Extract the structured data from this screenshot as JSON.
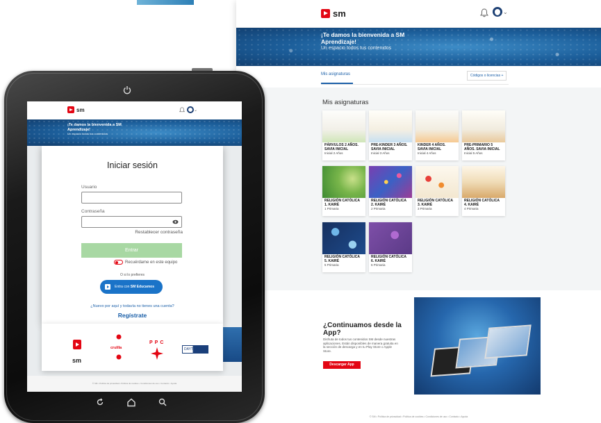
{
  "colors": {
    "brand_red": "#e30613",
    "link_blue": "#1a5fa8",
    "banner_blue": "#1c5e9a",
    "enter_green": "#a8d8a3"
  },
  "desktop": {
    "logo_text": "sm",
    "banner_title": "¡Te damos la bienvenida a SM Aprendizaje!",
    "banner_sub": "Un espacio todos tus contenidos",
    "tab_subjects": "Mis asignaturas",
    "codes_button": "Códigos o licencias +",
    "section_title": "Mis asignaturas",
    "cards": [
      {
        "title": "PÁRVULOS 2 AÑOS. SAVIA INICIAL",
        "sub": "Inicial 2 Años"
      },
      {
        "title": "PRE-KINDER 3 AÑOS. SAVIA INICIAL",
        "sub": "Inicial 3 Años"
      },
      {
        "title": "KINDER 4 AÑOS. SAVIA INICIAL",
        "sub": "Inicial 4 Años"
      },
      {
        "title": "PRE-PRIMARIO 5 AÑOS. SAVIA INICIAL",
        "sub": "Inicial 5 Años"
      },
      {
        "title": "RELIGIÓN CATÓLICA 1. KAIRÉ",
        "sub": "1 Primaria"
      },
      {
        "title": "RELIGIÓN CATÓLICA 2. KAIRÉ",
        "sub": "2 Primaria"
      },
      {
        "title": "RELIGIÓN CATÓLICA 3. KAIRÉ",
        "sub": "3 Primaria"
      },
      {
        "title": "RELIGIÓN CATÓLICA 4. KAIRÉ",
        "sub": "4 Primaria"
      },
      {
        "title": "RELIGIÓN CATÓLICA 5. KAIRÉ",
        "sub": "5 Primaria"
      },
      {
        "title": "RELIGIÓN CATÓLICA 6. KAIRÉ",
        "sub": "6 Primaria"
      }
    ],
    "app_title": "¿Continuamos desde la App?",
    "app_desc": "Disfruta de todos tus contenidos SM desde nuestras aplicaciones. Están disponibles de manera gratuita en la sección de descarga y en tu Play Store o Apple Store.",
    "app_button": "Descargar App",
    "footer": "© SM • Política de privacidad • Política de cookies • Condiciones de uso • Contacto • Ayuda"
  },
  "tablet": {
    "logo_text": "sm",
    "banner_title": "¡Te damos la bienvenida a SM Aprendizaje!",
    "banner_sub": "Un espacio todos tus contenidos",
    "login": {
      "title": "Iniciar sesión",
      "user_label": "Usuario",
      "user_value": "",
      "password_label": "Contraseña",
      "password_value": "",
      "reset_link": "Restablecer contraseña",
      "enter_button": "Entrar",
      "remember_label": "Recuérdame en este equipo",
      "or_text": "O si lo prefieres",
      "educamos_prefix": "Entra con",
      "educamos_strong": "SM Educamos",
      "new_question": "¿Nuevo por aquí y todavía no tienes una cuenta?",
      "register_link": "Regístrate"
    },
    "brands": {
      "sm": "sm",
      "cruilla": "cruïlla",
      "ppc": "PPC",
      "dayton": "DAYTON"
    },
    "footer": "© SM • Política de privacidad • Política de cookies • Condiciones de uso • Contacto • Ayuda"
  }
}
